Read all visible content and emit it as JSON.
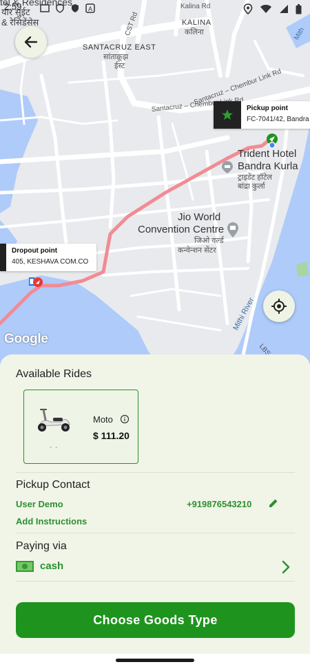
{
  "status_bar": {
    "time": "2:59"
  },
  "map": {
    "labels": {
      "top_left_1": "tel & Residences",
      "top_left_2": "यार सुईट",
      "top_left_3": "& रेसिडेंसेस",
      "kalina_en": "KALINA",
      "kalina_hi": "कलिना",
      "kalina_road": "Kalina Rd",
      "cst_road": "CST Rd",
      "santacruz_en": "SANTACRUZ EAST",
      "santacruz_hi1": "सांताक्रूझ",
      "santacruz_hi2": "ईस्ट",
      "link_road_1": "Santacruz – Chembur Link Rd",
      "link_road_2": "Santacruz – Chembur Link Rd",
      "trident_en1": "Trident Hotel",
      "trident_en2": "Bandra Kurla",
      "trident_hi1": "ट्राइडेंट हॉटेल",
      "trident_hi2": "बांद्रा कुर्ला",
      "jio_en1": "Jio World",
      "jio_en2": "Convention Centre",
      "jio_hi1": "जिओ वर्ल्ड",
      "jio_hi2": "कन्वेन्शन सेंटर",
      "mithi_river": "Mithi River",
      "mithi_top": "Mith",
      "lbs_marg": "LBS Marg"
    },
    "pickup": {
      "title": "Pickup point",
      "address": "FC-7041/42, Bandra"
    },
    "dropout": {
      "title": "Dropout point",
      "address": "405, KESHAVA COM.CO"
    },
    "google_logo": "Google",
    "route_color": "#f28b94",
    "water_color": "#aecbfa"
  },
  "sheet": {
    "available_rides_title": "Available Rides",
    "ride": {
      "name": "Moto",
      "price": "$ 111.20",
      "eta": "- -"
    },
    "pickup_contact_title": "Pickup Contact",
    "contact_name": "User Demo",
    "contact_phone": "+919876543210",
    "add_instructions": "Add Instructions",
    "paying_via_title": "Paying via",
    "payment_method": "cash",
    "cta_label": "Choose Goods Type",
    "accent_color": "#1e941e"
  }
}
